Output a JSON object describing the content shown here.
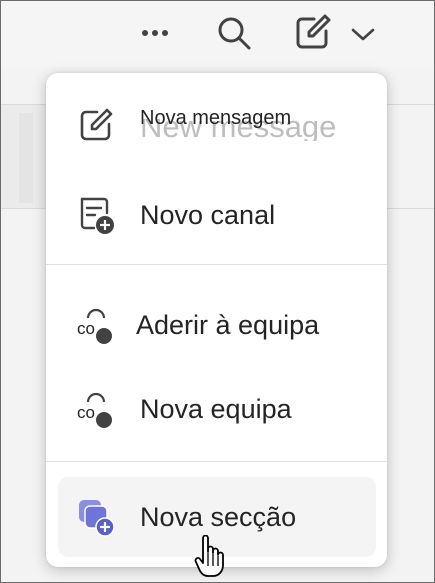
{
  "toolbar": {
    "more_icon": "more-horizontal-icon",
    "search_icon": "search-icon",
    "compose_icon": "compose-icon",
    "dropdown_icon": "chevron-down-icon"
  },
  "menu": {
    "items": [
      {
        "label": "Nova mensagem",
        "ghost": "New message",
        "icon": "compose-icon"
      },
      {
        "label": "Novo canal",
        "icon": "channel-add-icon"
      },
      {
        "label": "Aderir à equipa",
        "icon": "team-join-icon",
        "icon_text": "co"
      },
      {
        "label": "Nova equipa",
        "icon": "team-add-icon",
        "icon_text": "co"
      },
      {
        "label": "Nova secção",
        "icon": "section-add-icon"
      }
    ]
  },
  "colors": {
    "accent": "#5b5fc7",
    "text": "#242424",
    "hover": "#f4f4f4"
  }
}
